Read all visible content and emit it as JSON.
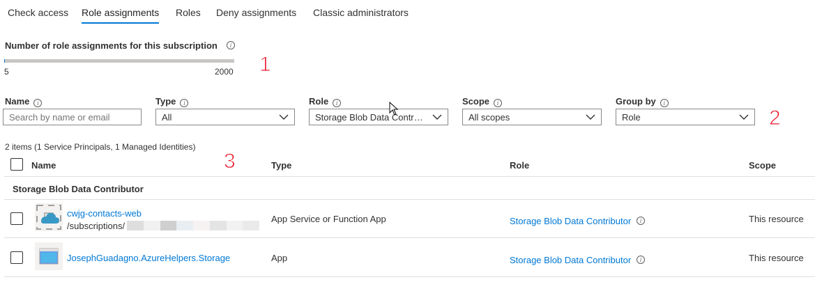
{
  "tabs": [
    {
      "label": "Check access"
    },
    {
      "label": "Role assignments"
    },
    {
      "label": "Roles"
    },
    {
      "label": "Deny assignments"
    },
    {
      "label": "Classic administrators"
    }
  ],
  "count": {
    "title": "Number of role assignments for this subscription",
    "current": "5",
    "max": "2000",
    "fill_fraction": 0.0025
  },
  "callouts": {
    "one": "1",
    "two": "2",
    "three": "3"
  },
  "filters": {
    "name": {
      "label": "Name",
      "placeholder": "Search by name or email"
    },
    "type": {
      "label": "Type",
      "value": "All"
    },
    "role": {
      "label": "Role",
      "value": "Storage Blob Data Contributor"
    },
    "scope": {
      "label": "Scope",
      "value": "All scopes"
    },
    "group_by": {
      "label": "Group by",
      "value": "Role"
    }
  },
  "summary": "2 items (1 Service Principals, 1 Managed Identities)",
  "table": {
    "columns": {
      "name": "Name",
      "type": "Type",
      "role": "Role",
      "scope": "Scope"
    },
    "group": "Storage Blob Data Contributor",
    "rows": [
      {
        "name": "cwjg-contacts-web",
        "subpath": "/subscriptions/",
        "type": "App Service or Function App",
        "role": "Storage Blob Data Contributor",
        "scope": "This resource"
      },
      {
        "name": "JosephGuadagno.AzureHelpers.Storage",
        "type": "App",
        "role": "Storage Blob Data Contributor",
        "scope": "This resource"
      }
    ]
  },
  "colors": {
    "accent": "#0078d4",
    "callout": "#e81123",
    "border": "#8a8886"
  }
}
